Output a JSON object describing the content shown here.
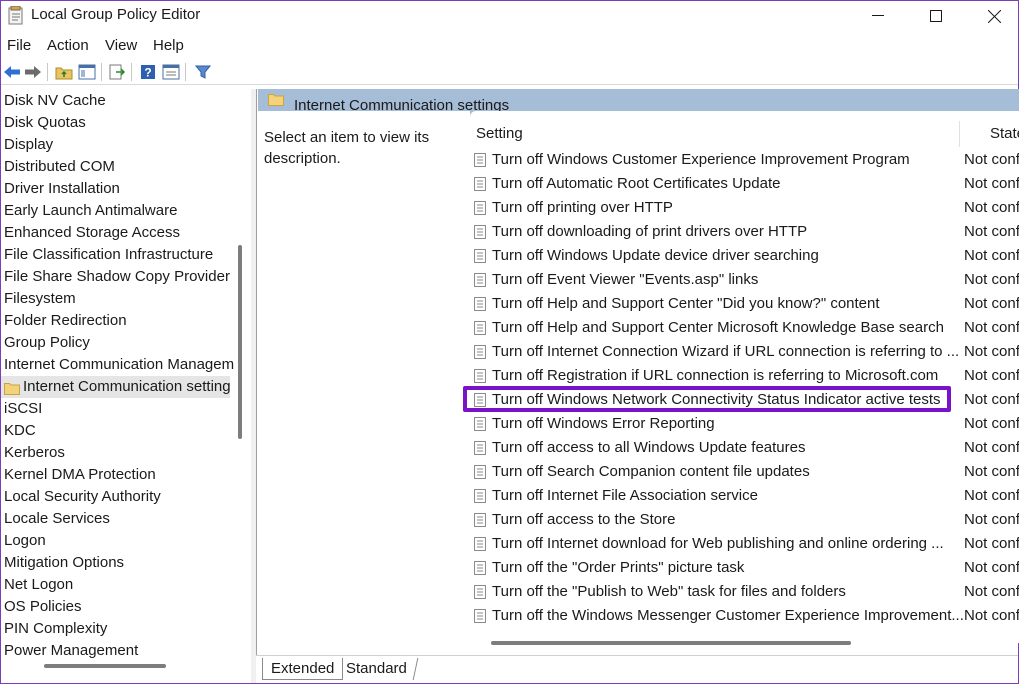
{
  "window": {
    "title": "Local Group Policy Editor"
  },
  "menu": [
    "File",
    "Action",
    "View",
    "Help"
  ],
  "tree": {
    "items": [
      "Disk NV Cache",
      "Disk Quotas",
      "Display",
      "Distributed COM",
      "Driver Installation",
      "Early Launch Antimalware",
      "Enhanced Storage Access",
      "File Classification Infrastructure",
      "File Share Shadow Copy Provider",
      "Filesystem",
      "Folder Redirection",
      "Group Policy",
      "Internet Communication Managem",
      "Internet Communication setting",
      "iSCSI",
      "KDC",
      "Kerberos",
      "Kernel DMA Protection",
      "Local Security Authority",
      "Locale Services",
      "Logon",
      "Mitigation Options",
      "Net Logon",
      "OS Policies",
      "PIN Complexity",
      "Power Management"
    ],
    "selected_index": 13
  },
  "details": {
    "header_title": "Internet Communication settings",
    "description": "Select an item to view its description.",
    "columns": {
      "setting": "Setting",
      "state": "State"
    },
    "rows": [
      {
        "setting": "Turn off Windows Customer Experience Improvement Program",
        "state": "Not configured"
      },
      {
        "setting": "Turn off Automatic Root Certificates Update",
        "state": "Not configured"
      },
      {
        "setting": "Turn off printing over HTTP",
        "state": "Not configured"
      },
      {
        "setting": "Turn off downloading of print drivers over HTTP",
        "state": "Not configured"
      },
      {
        "setting": "Turn off Windows Update device driver searching",
        "state": "Not configured"
      },
      {
        "setting": "Turn off Event Viewer \"Events.asp\" links",
        "state": "Not configured"
      },
      {
        "setting": "Turn off Help and Support Center \"Did you know?\" content",
        "state": "Not configured"
      },
      {
        "setting": "Turn off Help and Support Center Microsoft Knowledge Base search",
        "state": "Not configured"
      },
      {
        "setting": "Turn off Internet Connection Wizard if URL connection is referring to ...",
        "state": "Not configured"
      },
      {
        "setting": "Turn off Registration if URL connection is referring to Microsoft.com",
        "state": "Not configured"
      },
      {
        "setting": "Turn off Windows Network Connectivity Status Indicator active tests",
        "state": "Not configured"
      },
      {
        "setting": "Turn off Windows Error Reporting",
        "state": "Not configured"
      },
      {
        "setting": "Turn off access to all Windows Update features",
        "state": "Not configured"
      },
      {
        "setting": "Turn off Search Companion content file updates",
        "state": "Not configured"
      },
      {
        "setting": "Turn off Internet File Association service",
        "state": "Not configured"
      },
      {
        "setting": "Turn off access to the Store",
        "state": "Not configured"
      },
      {
        "setting": "Turn off Internet download for Web publishing and online ordering ...",
        "state": "Not configured"
      },
      {
        "setting": "Turn off the \"Order Prints\" picture task",
        "state": "Not configured"
      },
      {
        "setting": "Turn off the \"Publish to Web\" task for files and folders",
        "state": "Not configured"
      },
      {
        "setting": "Turn off the Windows Messenger Customer Experience Improvement...",
        "state": "Not configured"
      }
    ],
    "highlighted_index": 10
  },
  "tabs": [
    "Extended",
    "Standard"
  ],
  "colors": {
    "header_band": "#a6bdd7",
    "highlight_border": "#7a12c9",
    "window_border": "#7a3fb8"
  }
}
